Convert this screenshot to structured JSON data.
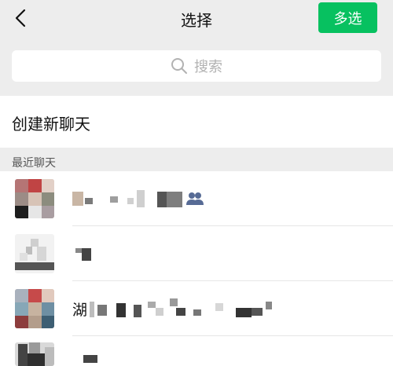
{
  "nav": {
    "title": "选择",
    "multi_select_label": "多选"
  },
  "search": {
    "placeholder": "搜索"
  },
  "new_chat": {
    "label": "创建新聊天"
  },
  "recent": {
    "section_label": "最近聊天"
  },
  "chats": [
    {
      "visible_name": ""
    },
    {
      "visible_name": ""
    },
    {
      "visible_name": "湖"
    },
    {
      "visible_name": ""
    }
  ],
  "colors": {
    "accent": "#07c160",
    "background": "#ededed"
  }
}
